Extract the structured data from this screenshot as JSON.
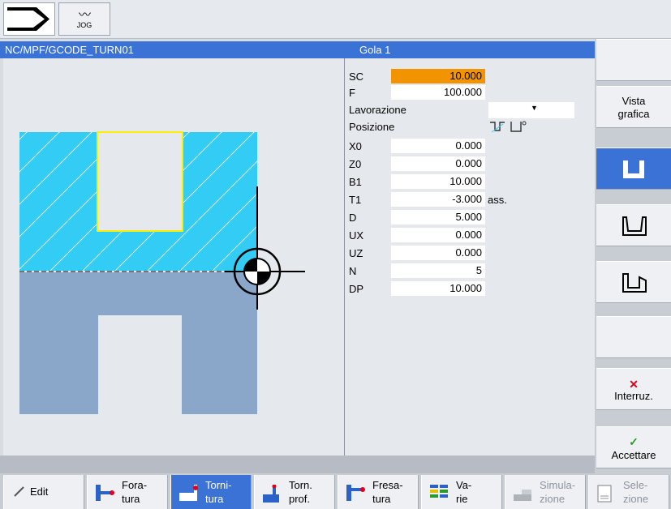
{
  "topbar": {
    "nc_icon": "program-arrow-icon",
    "mode_icon": "jog-wave-icon",
    "mode_label": "JOG"
  },
  "title": {
    "path": "NC/MPF/GCODE_TURN01",
    "cycle": "Gola 1"
  },
  "params": [
    {
      "label": "SC",
      "value": "10.000",
      "unit": "",
      "selected": true
    },
    {
      "label": "F",
      "value": "100.000",
      "unit": ""
    },
    {
      "label": "Lavorazione",
      "type": "dropdown",
      "value": ""
    },
    {
      "label": "Posizione",
      "type": "icons",
      "icon": "groove-position-icon"
    },
    {
      "label": "X0",
      "value": "0.000",
      "unit": ""
    },
    {
      "label": "Z0",
      "value": "0.000",
      "unit": ""
    },
    {
      "label": "B1",
      "value": "10.000",
      "unit": ""
    },
    {
      "label": "T1",
      "value": "-3.000",
      "unit": "ass."
    },
    {
      "label": "D",
      "value": "5.000",
      "unit": ""
    },
    {
      "label": "UX",
      "value": "0.000",
      "unit": ""
    },
    {
      "label": "UZ",
      "value": "0.000",
      "unit": ""
    },
    {
      "label": "N",
      "value": "5",
      "unit": ""
    },
    {
      "label": "DP",
      "value": "10.000",
      "unit": ""
    }
  ],
  "softkeys_vertical": {
    "vista_l1": "Vista",
    "vista_l2": "grafica",
    "interrupt": "Interruz.",
    "accept": "Accettare"
  },
  "softkeys_horizontal": [
    {
      "l1": "Edit",
      "l2": ""
    },
    {
      "l1": "Fora-",
      "l2": "tura"
    },
    {
      "l1": "Torni-",
      "l2": "tura"
    },
    {
      "l1": "Torn.",
      "l2": "prof."
    },
    {
      "l1": "Fresa-",
      "l2": "tura"
    },
    {
      "l1": "Va-",
      "l2": "rie"
    },
    {
      "l1": "Simula-",
      "l2": "zione"
    },
    {
      "l1": "Sele-",
      "l2": "zione"
    }
  ],
  "colors": {
    "accent": "#3b72d6",
    "selected": "#f29400",
    "workpiece": "#33ccf5",
    "stock": "#8aa6c8",
    "groove_outline": "#ffee00"
  }
}
